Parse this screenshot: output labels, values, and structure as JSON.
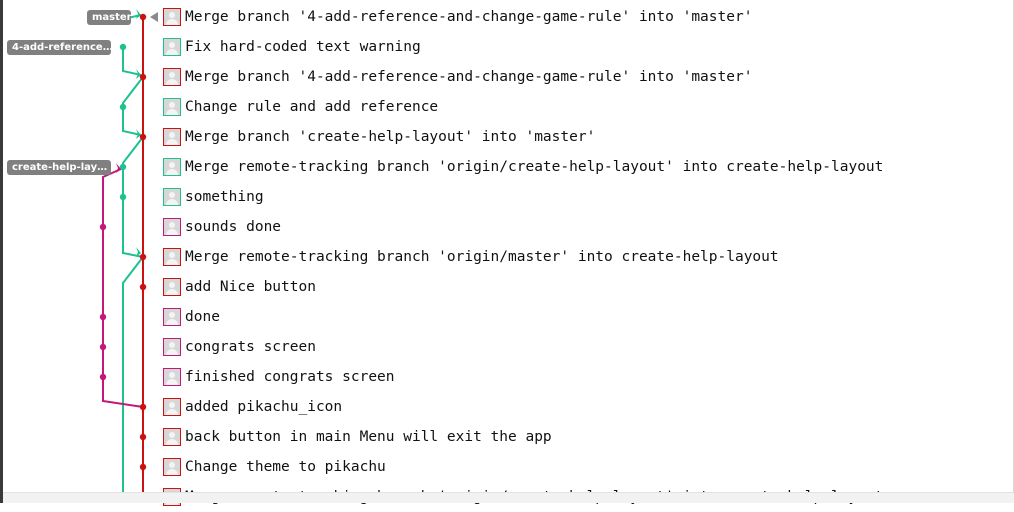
{
  "colors": {
    "master": "#cc1111",
    "feature_branch": "#1ec28e",
    "help_branch": "#c2187a",
    "label_bg": "#808080"
  },
  "refs": [
    {
      "id": "master",
      "label": "master",
      "row": 0
    },
    {
      "id": "4-add-reference",
      "label": "4-add-reference…",
      "row": 1
    },
    {
      "id": "create-help-layout",
      "label": "create-help-lay…",
      "row": 5
    }
  ],
  "commits": [
    {
      "message": "Merge branch '4-add-reference-and-change-game-rule' into 'master'",
      "lane": "master",
      "avatar_color": "red"
    },
    {
      "message": "Fix hard-coded text warning",
      "lane": "feature",
      "avatar_color": "green"
    },
    {
      "message": "Merge branch '4-add-reference-and-change-game-rule' into 'master'",
      "lane": "master",
      "avatar_color": "red"
    },
    {
      "message": "Change rule and add reference",
      "lane": "feature",
      "avatar_color": "green"
    },
    {
      "message": "Merge branch 'create-help-layout' into 'master'",
      "lane": "master",
      "avatar_color": "red"
    },
    {
      "message": "Merge remote-tracking branch 'origin/create-help-layout' into create-help-layout",
      "lane": "feature",
      "avatar_color": "green"
    },
    {
      "message": "something",
      "lane": "feature",
      "avatar_color": "green"
    },
    {
      "message": "sounds done",
      "lane": "help",
      "avatar_color": "magenta"
    },
    {
      "message": "Merge remote-tracking branch 'origin/master' into create-help-layout",
      "lane": "master",
      "avatar_color": "red"
    },
    {
      "message": "add Nice button",
      "lane": "master",
      "avatar_color": "red"
    },
    {
      "message": "done",
      "lane": "help",
      "avatar_color": "magenta"
    },
    {
      "message": "congrats screen",
      "lane": "help",
      "avatar_color": "magenta"
    },
    {
      "message": "finished congrats screen",
      "lane": "help",
      "avatar_color": "magenta"
    },
    {
      "message": "added pikachu_icon",
      "lane": "master",
      "avatar_color": "red"
    },
    {
      "message": "back button in main Menu will exit the app",
      "lane": "master",
      "avatar_color": "red"
    },
    {
      "message": "Change theme to pikachu",
      "lane": "master",
      "avatar_color": "red"
    },
    {
      "message": "Merge remote-tracking branch 'origin/create-help-layout' into create-help-layout",
      "lane": "master",
      "avatar_color": "red"
    }
  ]
}
